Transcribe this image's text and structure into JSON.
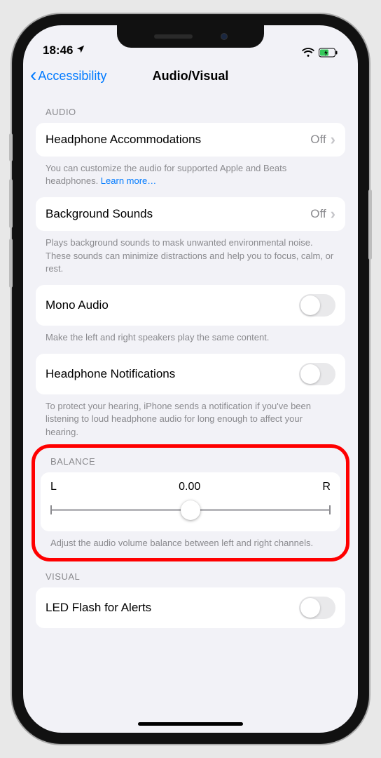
{
  "statusbar": {
    "time": "18:46"
  },
  "nav": {
    "back_label": "Accessibility",
    "title": "Audio/Visual"
  },
  "sections": {
    "audio_header": "AUDIO",
    "balance_header": "BALANCE",
    "visual_header": "VISUAL"
  },
  "rows": {
    "headphone_accommodations": {
      "label": "Headphone Accommodations",
      "value": "Off"
    },
    "background_sounds": {
      "label": "Background Sounds",
      "value": "Off"
    },
    "mono_audio": {
      "label": "Mono Audio"
    },
    "headphone_notifications": {
      "label": "Headphone Notifications"
    },
    "led_flash": {
      "label": "LED Flash for Alerts"
    }
  },
  "footers": {
    "headphone_accommodations": "You can customize the audio for supported Apple and Beats headphones. ",
    "headphone_accommodations_link": "Learn more…",
    "background_sounds": "Plays background sounds to mask unwanted environmental noise. These sounds can minimize distractions and help you to focus, calm, or rest.",
    "mono_audio": "Make the left and right speakers play the same content.",
    "headphone_notifications": "To protect your hearing, iPhone sends a notification if you've been listening to loud headphone audio for long enough to affect your hearing.",
    "balance": "Adjust the audio volume balance between left and right channels."
  },
  "balance": {
    "left_label": "L",
    "right_label": "R",
    "value_text": "0.00",
    "value": 0.0
  }
}
